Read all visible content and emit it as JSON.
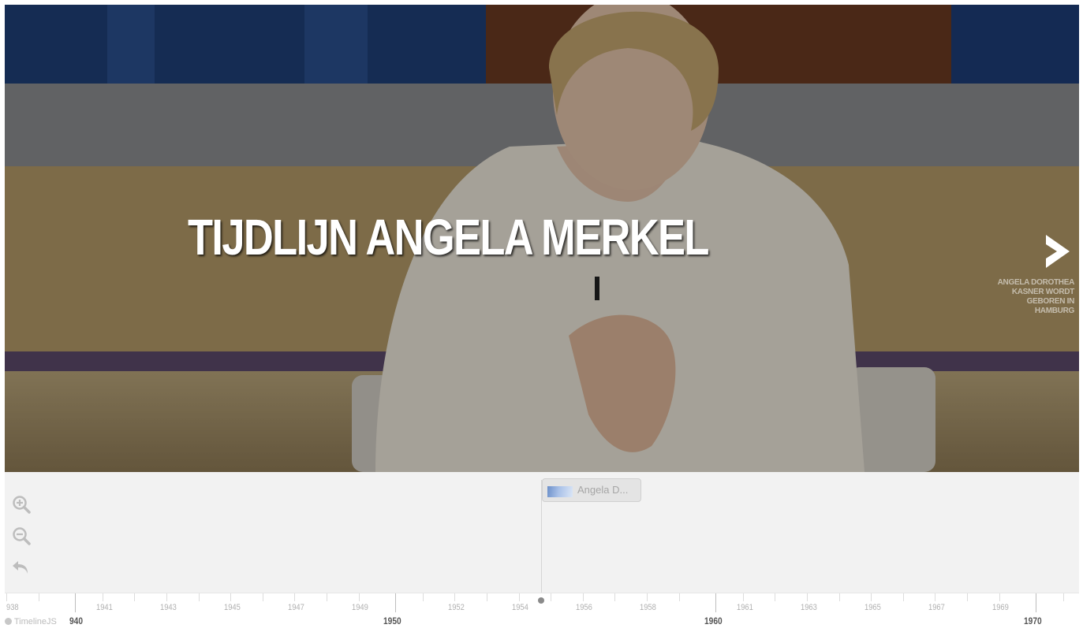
{
  "slide": {
    "title": "TIJDLIJN ANGELA MERKEL",
    "background_image": "woman in cream jacket speaking in TV studio"
  },
  "next_nav": {
    "icon": "chevron-right-icon",
    "caption_lines": [
      "ANGELA DOROTHEA",
      "KASNER WORDT",
      "GEBOREN IN",
      "HAMBURG"
    ]
  },
  "zoom_controls": {
    "zoom_in_icon": "zoom-in-icon",
    "zoom_out_icon": "zoom-out-icon",
    "back_icon": "back-to-start-icon"
  },
  "timeline_marker": {
    "label": "Angela D..."
  },
  "timeaxis": {
    "minor_years": [
      "938",
      "1941",
      "1943",
      "1945",
      "1947",
      "1949",
      "1952",
      "1954",
      "1956",
      "1958",
      "1961",
      "1963",
      "1965",
      "1967",
      "1969"
    ],
    "major_years": [
      "940",
      "1950",
      "1960",
      "1970"
    ]
  },
  "branding": {
    "text": "TimelineJS"
  },
  "colors": {
    "nav_background": "#f2f2f2",
    "title_text": "#ffffff",
    "axis_major_text": "#555555",
    "axis_minor_text": "#b0b0b0"
  }
}
